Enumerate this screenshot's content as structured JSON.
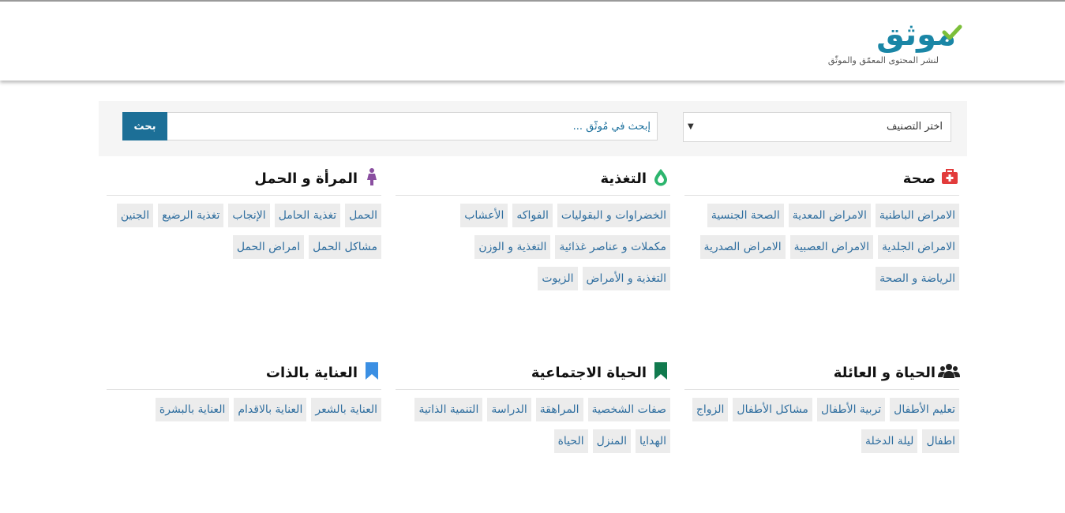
{
  "header": {
    "logo_text": "موثق",
    "tagline": "لنشر المحتوى المعمّق والموثّق"
  },
  "search": {
    "category_label": "اختر التصنيف",
    "placeholder": "إبحث في مُوثّق ...",
    "button_label": "بحث"
  },
  "colors": {
    "brand_blue": "#1a86a6",
    "check_green": "#7cbf3a",
    "search_button": "#1c6f97",
    "tag_text": "#2f6e9f",
    "health_icon": "#e23b3b",
    "nutrition_icon": "#2db56e",
    "woman_icon": "#8a4fa0",
    "family_icon": "#222222",
    "social_icon": "#117a4e",
    "selfcare_icon": "#3b8fe3"
  },
  "categories": [
    {
      "title": "صحة",
      "icon": "first-aid-kit-icon",
      "tags": [
        "الامراض الباطنية",
        "الامراض المعدية",
        "الصحة الجنسية",
        "الامراض الجلدية",
        "الامراض العصبية",
        "الامراض الصدرية",
        "الرياضة و الصحة"
      ]
    },
    {
      "title": "التغذية",
      "icon": "water-drop-icon",
      "tags": [
        "الخضراوات و البقوليات",
        "الفواكه",
        "الأعشاب",
        "مكملات و عناصر غذائية",
        "التغذية و الوزن",
        "التغذية و الأمراض",
        "الزيوت"
      ]
    },
    {
      "title": "المرأة و الحمل",
      "icon": "woman-icon",
      "tags": [
        "الحمل",
        "تغذية الحامل",
        "الإنجاب",
        "تغذية الرضيع",
        "الجنين",
        "مشاكل الحمل",
        "امراض الحمل"
      ]
    },
    {
      "title": "الحياة و العائلة",
      "icon": "family-group-icon",
      "tags": [
        "تعليم الأطفال",
        "تربية الأطفال",
        "مشاكل الأطفال",
        "الزواج",
        "اطفال",
        "ليلة الدخلة"
      ]
    },
    {
      "title": "الحياة الاجتماعية",
      "icon": "bookmark-icon",
      "tags": [
        "صفات الشخصية",
        "المراهقة",
        "الدراسة",
        "التنمية الذاتية",
        "الهدايا",
        "المنزل",
        "الحياة"
      ]
    },
    {
      "title": "العناية بالذات",
      "icon": "bookmark-icon",
      "tags": [
        "العناية بالشعر",
        "العناية بالاقدام",
        "العناية بالبشرة"
      ]
    }
  ]
}
